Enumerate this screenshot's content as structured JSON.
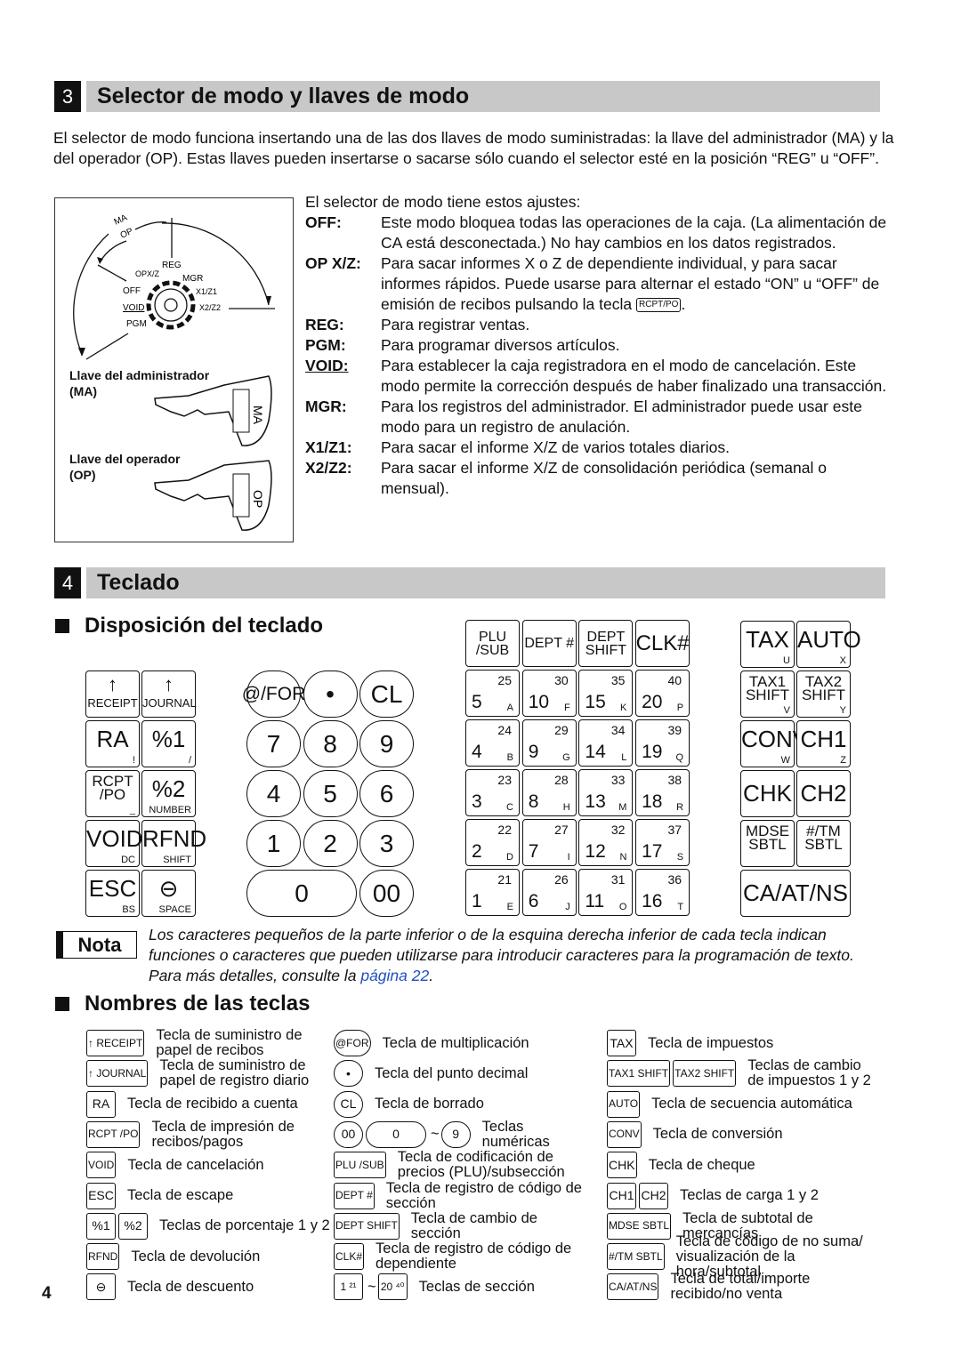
{
  "section3": {
    "number": "3",
    "title": "Selector de modo y llaves de modo",
    "intro": "El selector de modo funciona insertando una de las dos llaves de modo suministradas: la llave del administrador (MA) y la del operador (OP). Estas llaves pueden insertarse o sacarse sólo cuando el selector esté en la posición “REG” u “OFF”.",
    "diagram": {
      "arc_labels": [
        "MA",
        "OP"
      ],
      "positions": [
        "REG",
        "OPX/Z",
        "MGR",
        "OFF",
        "X1/Z1",
        "VOID",
        "X2/Z2",
        "PGM"
      ],
      "ma_key_label": "Llave del administrador",
      "ma_key_abbr": "(MA)",
      "ma_key_text": "MA",
      "op_key_label": "Llave del operador",
      "op_key_abbr": "(OP)",
      "op_key_text": "OP"
    },
    "modes_intro": "El selector de modo tiene estos ajustes:",
    "modes": [
      {
        "label": "OFF:",
        "text": "Este modo bloquea todas las operaciones de la caja. (La alimentación de CA está desconectada.) No hay cambios en los datos registrados."
      },
      {
        "label": "OP X/Z:",
        "text": "Para sacar informes X o Z de dependiente individual, y para sacar informes rápidos. Puede usarse para alternar el estado “ON” u “OFF” de emisión de recibos pulsando la tecla",
        "key": "RCPT/PO",
        "after": "."
      },
      {
        "label": "REG:",
        "text": "Para registrar ventas."
      },
      {
        "label": "PGM:",
        "text": "Para programar diversos artículos."
      },
      {
        "label": "VOID:",
        "text": "Para establecer la caja registradora en el modo de cancelación. Este modo permite la corrección después de haber finalizado una transacción."
      },
      {
        "label": "MGR:",
        "text": "Para los registros del administrador. El administrador puede usar este modo para un registro de anulación."
      },
      {
        "label": "X1/Z1:",
        "text": "Para sacar el informe X/Z de varios totales diarios."
      },
      {
        "label": "X2/Z2:",
        "text": "Para sacar el informe X/Z de consolidación periódica (semanal o mensual)."
      }
    ]
  },
  "section4": {
    "number": "4",
    "title": "Teclado",
    "layout_heading": "Disposición del teclado",
    "keyboard": {
      "function_keys": [
        [
          {
            "main": "↑",
            "small": "RECEIPT"
          },
          {
            "main": "↑",
            "small": "JOURNAL"
          }
        ],
        [
          {
            "main": "RA",
            "small": "!"
          },
          {
            "main": "%1",
            "small": "/"
          }
        ],
        [
          {
            "main": "RCPT /PO",
            "small": "_"
          },
          {
            "main": "%2",
            "small": "NUMBER"
          }
        ],
        [
          {
            "main": "VOID",
            "small": "DC"
          },
          {
            "main": "RFND",
            "small": "SHIFT"
          }
        ],
        [
          {
            "main": "ESC",
            "small": "BS"
          },
          {
            "main": "⊖",
            "small": "SPACE"
          }
        ]
      ],
      "numeric_keys": [
        [
          "@/FOR",
          "•",
          "CL"
        ],
        [
          "7",
          "8",
          "9"
        ],
        [
          "4",
          "5",
          "6"
        ],
        [
          "1",
          "2",
          "3"
        ],
        [
          "0",
          "00"
        ]
      ],
      "dept_header_keys": [
        "PLU /SUB",
        "DEPT #",
        "DEPT SHIFT",
        "CLK#"
      ],
      "dept_keys": [
        [
          {
            "n": "5",
            "t": "25",
            "c": "A"
          },
          {
            "n": "10",
            "t": "30",
            "c": "F"
          },
          {
            "n": "15",
            "t": "35",
            "c": "K"
          },
          {
            "n": "20",
            "t": "40",
            "c": "P"
          }
        ],
        [
          {
            "n": "4",
            "t": "24",
            "c": "B"
          },
          {
            "n": "9",
            "t": "29",
            "c": "G"
          },
          {
            "n": "14",
            "t": "34",
            "c": "L"
          },
          {
            "n": "19",
            "t": "39",
            "c": "Q"
          }
        ],
        [
          {
            "n": "3",
            "t": "23",
            "c": "C"
          },
          {
            "n": "8",
            "t": "28",
            "c": "H"
          },
          {
            "n": "13",
            "t": "33",
            "c": "M"
          },
          {
            "n": "18",
            "t": "38",
            "c": "R"
          }
        ],
        [
          {
            "n": "2",
            "t": "22",
            "c": "D"
          },
          {
            "n": "7",
            "t": "27",
            "c": "I"
          },
          {
            "n": "12",
            "t": "32",
            "c": "N"
          },
          {
            "n": "17",
            "t": "37",
            "c": "S"
          }
        ],
        [
          {
            "n": "1",
            "t": "21",
            "c": "E"
          },
          {
            "n": "6",
            "t": "26",
            "c": "J"
          },
          {
            "n": "11",
            "t": "31",
            "c": "O"
          },
          {
            "n": "16",
            "t": "36",
            "c": "T"
          }
        ]
      ],
      "right_keys": [
        [
          {
            "main": "TAX",
            "small": "U"
          },
          {
            "main": "AUTO",
            "small": "X"
          }
        ],
        [
          {
            "main": "TAX1 SHIFT",
            "small": "V"
          },
          {
            "main": "TAX2 SHIFT",
            "small": "Y"
          }
        ],
        [
          {
            "main": "CONV",
            "small": "W"
          },
          {
            "main": "CH1",
            "small": "Z"
          }
        ],
        [
          {
            "main": "CHK",
            "small": ""
          },
          {
            "main": "CH2",
            "small": ""
          }
        ],
        [
          {
            "main": "MDSE SBTL",
            "small": ""
          },
          {
            "main": "#/TM SBTL",
            "small": ""
          }
        ],
        [
          {
            "main": "CA/AT/NS",
            "small": ""
          }
        ]
      ]
    },
    "note": {
      "label": "Nota",
      "text": "Los caracteres pequeños de la parte inferior o de la esquina derecha inferior de cada tecla indican funciones o caracteres que pueden utilizarse para introducir caracteres para la programación de texto. Para más detalles, consulte la",
      "link": "página 22",
      "after": ".",
      "link_color": "#1f4fbf"
    },
    "names_heading": "Nombres de las teclas",
    "key_names": [
      [
        {
          "icons": [
            "↑ RECEIPT"
          ],
          "text": "Tecla de suministro de papel de recibos"
        },
        {
          "icons": [
            "↑ JOURNAL"
          ],
          "text": "Tecla de suministro de papel de registro diario"
        },
        {
          "icons": [
            "RA"
          ],
          "text": "Tecla de recibido a cuenta"
        },
        {
          "icons": [
            "RCPT /PO"
          ],
          "text": "Tecla de impresión de recibos/pagos"
        },
        {
          "icons": [
            "VOID"
          ],
          "text": "Tecla de cancelación"
        },
        {
          "icons": [
            "ESC"
          ],
          "text": "Tecla de escape"
        },
        {
          "icons": [
            "%1",
            "%2"
          ],
          "text": "Teclas de porcentaje 1 y 2"
        },
        {
          "icons": [
            "RFND"
          ],
          "text": "Tecla de devolución"
        },
        {
          "icons": [
            "⊖"
          ],
          "text": "Tecla de descuento"
        }
      ],
      [
        {
          "icons": [
            "@FOR"
          ],
          "round": true,
          "text": "Tecla de multiplicación"
        },
        {
          "icons": [
            "•"
          ],
          "round": true,
          "text": "Tecla del punto decimal"
        },
        {
          "icons": [
            "CL"
          ],
          "round": true,
          "text": "Tecla de borrado"
        },
        {
          "icons": [
            "00",
            "0",
            "~",
            "9"
          ],
          "round": true,
          "text": "Teclas numéricas"
        },
        {
          "icons": [
            "PLU /SUB"
          ],
          "text": "Tecla de codificación de precios (PLU)/subsección"
        },
        {
          "icons": [
            "DEPT #"
          ],
          "text": "Tecla de registro de código de sección"
        },
        {
          "icons": [
            "DEPT SHIFT"
          ],
          "text": "Tecla de cambio de sección"
        },
        {
          "icons": [
            "CLK#"
          ],
          "text": "Tecla de registro de código de dependiente"
        },
        {
          "icons": [
            "1 ²¹",
            "~",
            "20 ⁴⁰"
          ],
          "text": "Teclas de sección"
        }
      ],
      [
        {
          "icons": [
            "TAX"
          ],
          "text": "Tecla de impuestos"
        },
        {
          "icons": [
            "TAX1 SHIFT",
            "TAX2 SHIFT"
          ],
          "text": "Teclas de cambio de impuestos 1 y 2"
        },
        {
          "icons": [
            "AUTO"
          ],
          "text": "Tecla de secuencia automática"
        },
        {
          "icons": [
            "CONV"
          ],
          "text": "Tecla de conversión"
        },
        {
          "icons": [
            "CHK"
          ],
          "text": "Tecla de cheque"
        },
        {
          "icons": [
            "CH1",
            "CH2"
          ],
          "text": "Teclas de carga 1 y 2"
        },
        {
          "icons": [
            "MDSE SBTL"
          ],
          "text": "Tecla de subtotal de mercancías"
        },
        {
          "icons": [
            "#/TM SBTL"
          ],
          "text": "Tecla de código de no suma/ visualización de la hora/subtotal"
        },
        {
          "icons": [
            "CA/AT/NS"
          ],
          "text": "Tecla de total/importe recibido/no venta"
        }
      ]
    ]
  },
  "page_number": "4"
}
